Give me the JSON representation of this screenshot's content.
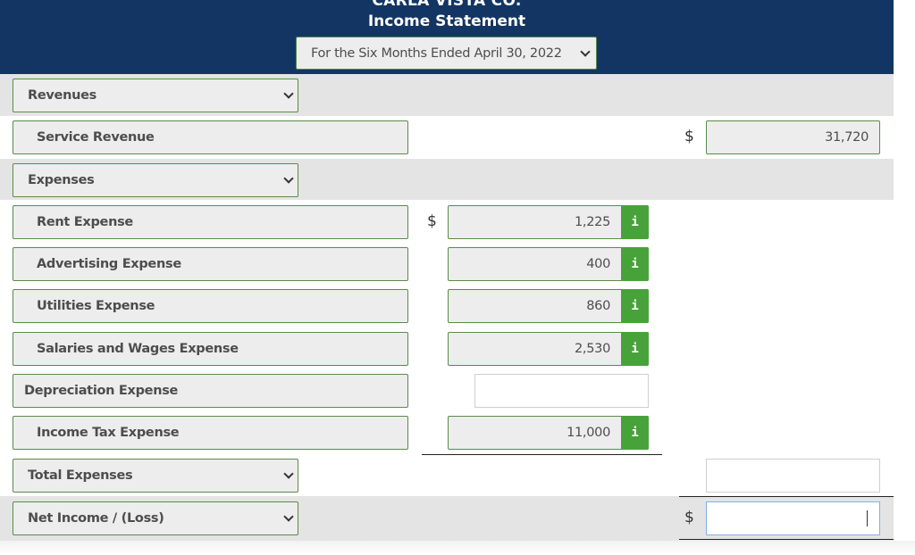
{
  "header": {
    "company": "CARLA VISTA CO.",
    "title": "Income Statement",
    "period_select": "For the Six Months Ended April 30, 2022"
  },
  "rows": {
    "revenues_heading": "Revenues",
    "service_revenue": {
      "label": "Service Revenue",
      "currency": "$",
      "amount": "31,720"
    },
    "expenses_heading": "Expenses",
    "expenses": [
      {
        "label": "Rent Expense",
        "currency": "$",
        "amount": "1,225",
        "info": "i"
      },
      {
        "label": "Advertising Expense",
        "amount": "400",
        "info": "i"
      },
      {
        "label": "Utilities Expense",
        "amount": "860",
        "info": "i"
      },
      {
        "label": "Salaries and Wages Expense",
        "amount": "2,530",
        "info": "i"
      },
      {
        "label": "Depreciation Expense",
        "amount": ""
      },
      {
        "label": "Income Tax Expense",
        "amount": "11,000",
        "info": "i"
      }
    ],
    "total_expenses": {
      "label": "Total Expenses",
      "amount": ""
    },
    "net_income": {
      "label": "Net Income / (Loss)",
      "currency": "$",
      "amount": ""
    }
  },
  "colors": {
    "header_bg": "#133563",
    "field_border": "#5c8a4a",
    "info_button": "#48a23a",
    "band_bg": "#e4e4e4",
    "focus_border": "#7fb2e5"
  }
}
